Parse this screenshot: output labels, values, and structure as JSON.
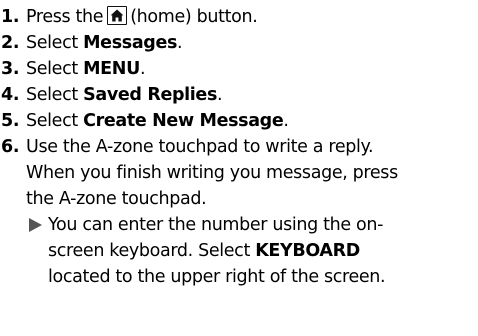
{
  "colors": {
    "text": "#000000",
    "note_arrow": "#555555",
    "button_border": "#111111"
  },
  "steps": [
    {
      "num": "1.",
      "before": "Press the",
      "icon": "home-icon",
      "after": "(home) button."
    },
    {
      "num": "2.",
      "before": "Select",
      "bold": "Messages",
      "after": "."
    },
    {
      "num": "3.",
      "before": "Select",
      "bold": "MENU",
      "after": "."
    },
    {
      "num": "4.",
      "before": "Select",
      "bold": "Saved Replies",
      "after": "."
    },
    {
      "num": "5.",
      "before": "Select",
      "bold": "Create New Message",
      "after": "."
    },
    {
      "num": "6.",
      "lines": [
        "Use the A-zone touchpad to write a reply.",
        "When you finish writing you message, press",
        "the A-zone touchpad."
      ],
      "note": {
        "icon": "arrow-right-icon",
        "line1": "You can enter the number using the on-",
        "line2_before": "screen keyboard. Select",
        "line2_bold": "KEYBOARD",
        "line3": "located to the upper right of the screen."
      }
    }
  ]
}
